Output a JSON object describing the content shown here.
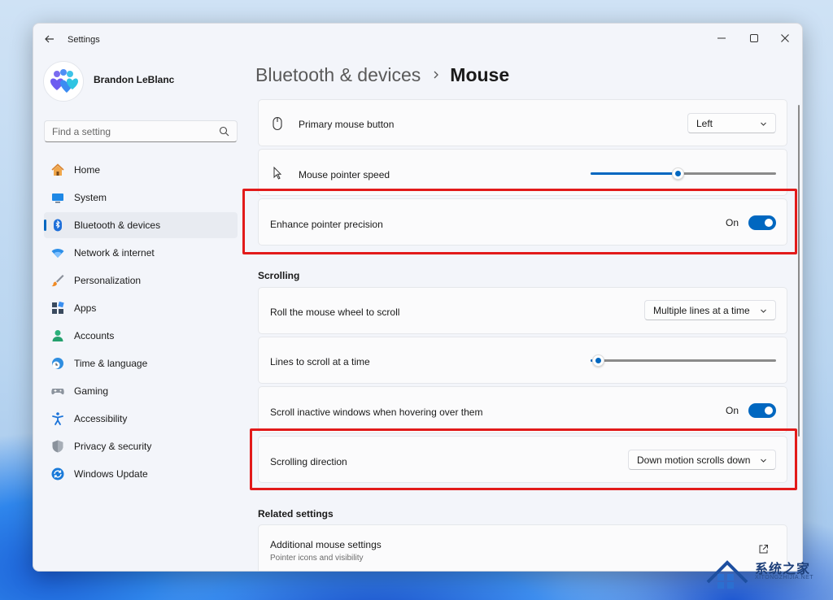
{
  "window": {
    "title": "Settings",
    "controls": {
      "minimize": "minimize",
      "maximize": "maximize",
      "close": "close"
    }
  },
  "profile": {
    "name": "Brandon LeBlanc"
  },
  "search": {
    "placeholder": "Find a setting"
  },
  "sidebar": {
    "items": [
      {
        "label": "Home",
        "icon": "home-icon"
      },
      {
        "label": "System",
        "icon": "system-icon"
      },
      {
        "label": "Bluetooth & devices",
        "icon": "bluetooth-icon",
        "active": true
      },
      {
        "label": "Network & internet",
        "icon": "wifi-icon"
      },
      {
        "label": "Personalization",
        "icon": "brush-icon"
      },
      {
        "label": "Apps",
        "icon": "apps-icon"
      },
      {
        "label": "Accounts",
        "icon": "accounts-icon"
      },
      {
        "label": "Time & language",
        "icon": "clock-globe-icon"
      },
      {
        "label": "Gaming",
        "icon": "gamepad-icon"
      },
      {
        "label": "Accessibility",
        "icon": "accessibility-icon"
      },
      {
        "label": "Privacy & security",
        "icon": "shield-icon"
      },
      {
        "label": "Windows Update",
        "icon": "update-icon"
      }
    ]
  },
  "breadcrumb": {
    "parent": "Bluetooth & devices",
    "current": "Mouse"
  },
  "settings": {
    "primary_button": {
      "label": "Primary mouse button",
      "value": "Left"
    },
    "pointer_speed": {
      "label": "Mouse pointer speed",
      "level": 0.47
    },
    "enhance_precision": {
      "label": "Enhance pointer precision",
      "state": "On"
    },
    "scrolling_title": "Scrolling",
    "roll_wheel": {
      "label": "Roll the mouse wheel to scroll",
      "value": "Multiple lines at a time"
    },
    "lines_to_scroll": {
      "label": "Lines to scroll at a time",
      "level": 0.04
    },
    "scroll_inactive": {
      "label": "Scroll inactive windows when hovering over them",
      "state": "On"
    },
    "scroll_direction": {
      "label": "Scrolling direction",
      "value": "Down motion scrolls down"
    },
    "related_title": "Related settings",
    "additional_mouse": {
      "label": "Additional mouse settings",
      "sub": "Pointer icons and visibility"
    }
  },
  "colors": {
    "accent": "#0067c0",
    "highlight": "#e21a1a"
  },
  "watermark": {
    "text": "系统之家",
    "sub": "XITONGZHIJIA.NET"
  }
}
